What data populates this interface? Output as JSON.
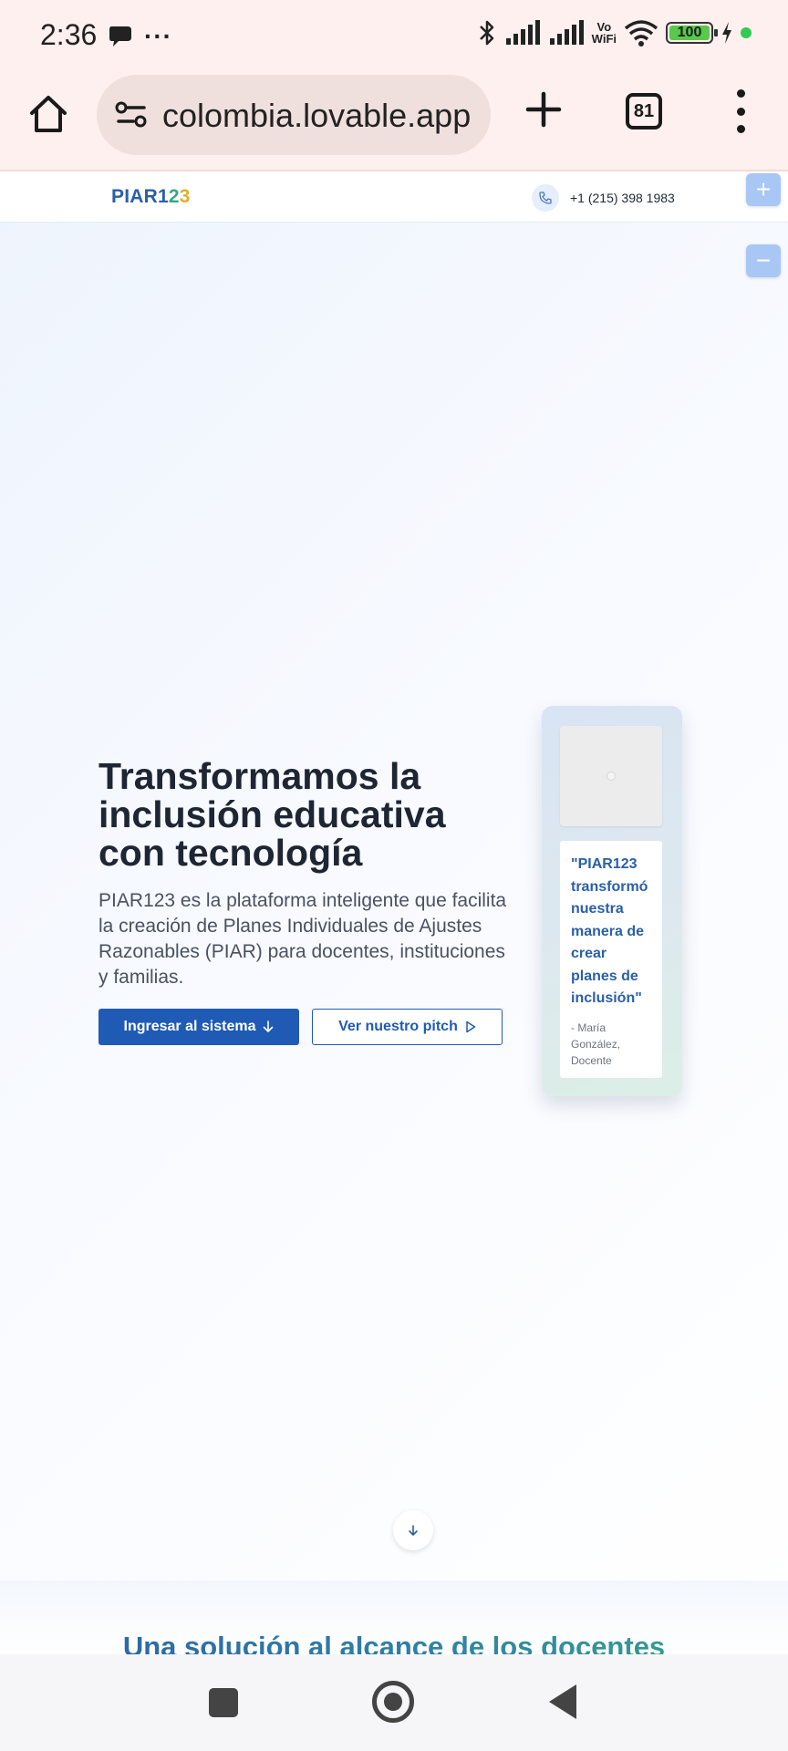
{
  "status_bar": {
    "time": "2:36",
    "ellipsis": "···",
    "vo_wifi_line1": "Vo",
    "vo_wifi_line2": "WiFi",
    "battery_level": "100"
  },
  "browser": {
    "url": "colombia.lovable.app",
    "tab_count": "81"
  },
  "site": {
    "logo": {
      "text": "PIAR",
      "digit1": "1",
      "digit2": "2",
      "digit3": "3"
    },
    "phone": "+1 (215) 398 1983",
    "zoom_in_label": "+",
    "zoom_out_label": "−"
  },
  "hero": {
    "title": "Transformamos la inclusión educativa con tecnología",
    "description": "PIAR123 es la plataforma inteligente que facilita la creación de Planes Individuales de Ajustes Razonables (PIAR) para docentes, instituciones y familias.",
    "primary_button": "Ingresar al sistema",
    "secondary_button": "Ver nuestro pitch"
  },
  "testimonial": {
    "quote": "\"PIAR123 transformó nuestra manera de crear planes de inclusión\"",
    "author": "- María González, Docente"
  },
  "next_section": {
    "title": "Una solución al alcance de los docentes"
  },
  "colors": {
    "brand_blue": "#2a5fa8",
    "brand_green": "#38a58a",
    "brand_yellow": "#e0b02a",
    "button_blue": "#1f5bb5"
  }
}
